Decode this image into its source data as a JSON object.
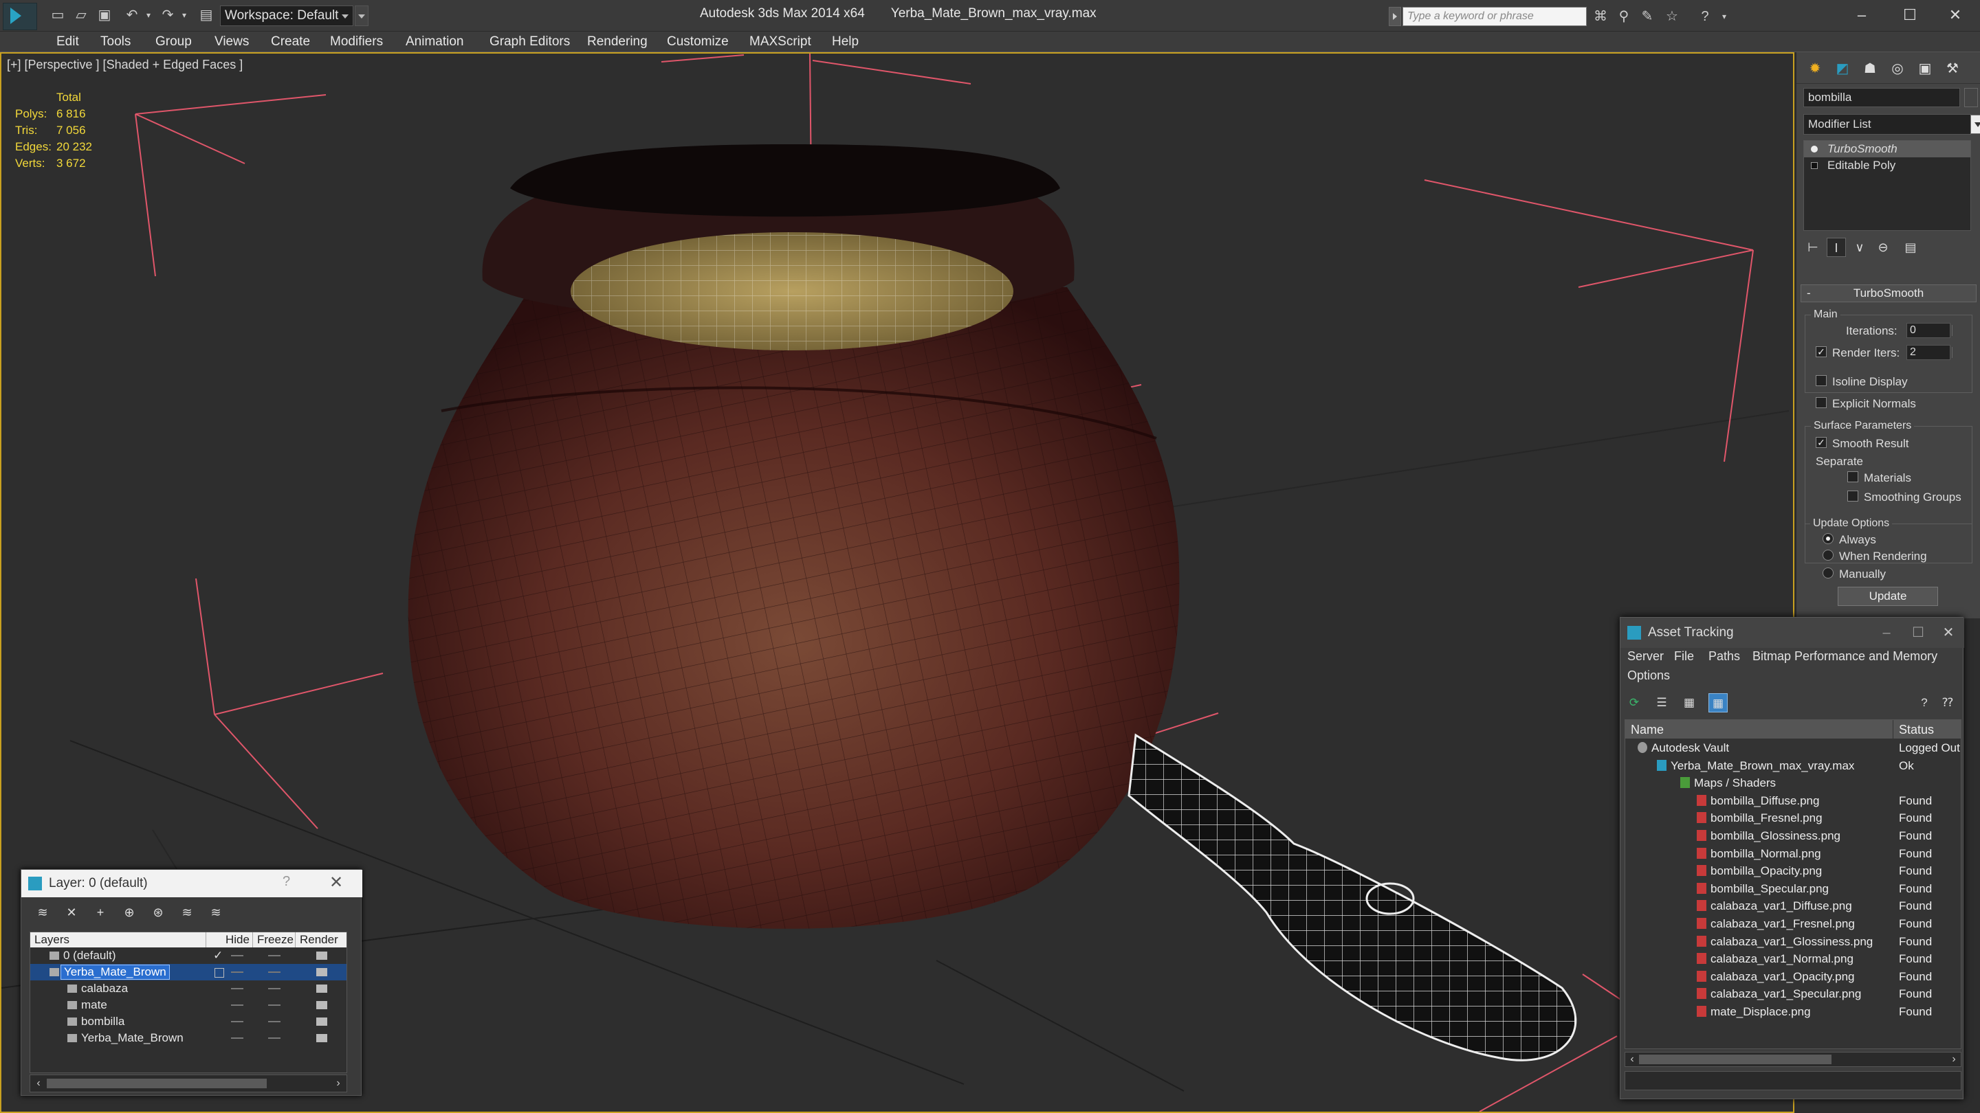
{
  "app": {
    "title": "Autodesk 3ds Max  2014 x64",
    "filename": "Yerba_Mate_Brown_max_vray.max",
    "workspace": "Workspace: Default",
    "search_placeholder": "Type a keyword or phrase"
  },
  "menu": [
    "Edit",
    "Tools",
    "Group",
    "Views",
    "Create",
    "Modifiers",
    "Animation",
    "Graph Editors",
    "Rendering",
    "Customize",
    "MAXScript",
    "Help"
  ],
  "viewport": {
    "label": "[+] [Perspective ] [Shaded + Edged Faces ]",
    "stats": {
      "header": "Total",
      "rows": [
        {
          "label": "Polys:",
          "value": "6 816"
        },
        {
          "label": "Tris:",
          "value": "7 056"
        },
        {
          "label": "Edges:",
          "value": "20 232"
        },
        {
          "label": "Verts:",
          "value": "3 672"
        }
      ]
    }
  },
  "command_panel": {
    "object_name": "bombilla",
    "modifier_list": "Modifier List",
    "stack": [
      "TurboSmooth",
      "Editable Poly"
    ],
    "rollout_title": "TurboSmooth",
    "rollout_minus": "-",
    "main": {
      "label": "Main",
      "iterations_label": "Iterations:",
      "iterations_value": "0",
      "render_iters_label": "Render Iters:",
      "render_iters_value": "2",
      "isoline_label": "Isoline Display",
      "explicit_label": "Explicit Normals"
    },
    "surface": {
      "label": "Surface Parameters",
      "smooth_result": "Smooth Result",
      "separate": "Separate",
      "materials": "Materials",
      "smoothing_groups": "Smoothing Groups"
    },
    "update": {
      "label": "Update Options",
      "always": "Always",
      "when_rendering": "When Rendering",
      "manually": "Manually",
      "button": "Update"
    }
  },
  "asset_tracking": {
    "title": "Asset Tracking",
    "menu": [
      "Server",
      "File",
      "Paths",
      "Bitmap Performance and Memory",
      "Options"
    ],
    "columns": {
      "name": "Name",
      "status": "Status"
    },
    "rows": [
      {
        "name": "Autodesk Vault",
        "status": "Logged Out",
        "level": 1,
        "icon": "vault-icon"
      },
      {
        "name": "Yerba_Mate_Brown_max_vray.max",
        "status": "Ok",
        "level": 2,
        "icon": "max-file-icon"
      },
      {
        "name": "Maps / Shaders",
        "status": "",
        "level": 3,
        "icon": "maps-folder-icon"
      },
      {
        "name": "bombilla_Diffuse.png",
        "status": "Found",
        "level": 4,
        "icon": "png-icon"
      },
      {
        "name": "bombilla_Fresnel.png",
        "status": "Found",
        "level": 4,
        "icon": "png-icon"
      },
      {
        "name": "bombilla_Glossiness.png",
        "status": "Found",
        "level": 4,
        "icon": "png-icon"
      },
      {
        "name": "bombilla_Normal.png",
        "status": "Found",
        "level": 4,
        "icon": "png-icon"
      },
      {
        "name": "bombilla_Opacity.png",
        "status": "Found",
        "level": 4,
        "icon": "png-icon"
      },
      {
        "name": "bombilla_Specular.png",
        "status": "Found",
        "level": 4,
        "icon": "png-icon"
      },
      {
        "name": "calabaza_var1_Diffuse.png",
        "status": "Found",
        "level": 4,
        "icon": "png-icon"
      },
      {
        "name": "calabaza_var1_Fresnel.png",
        "status": "Found",
        "level": 4,
        "icon": "png-icon"
      },
      {
        "name": "calabaza_var1_Glossiness.png",
        "status": "Found",
        "level": 4,
        "icon": "png-icon"
      },
      {
        "name": "calabaza_var1_Normal.png",
        "status": "Found",
        "level": 4,
        "icon": "png-icon"
      },
      {
        "name": "calabaza_var1_Opacity.png",
        "status": "Found",
        "level": 4,
        "icon": "png-icon"
      },
      {
        "name": "calabaza_var1_Specular.png",
        "status": "Found",
        "level": 4,
        "icon": "png-icon"
      },
      {
        "name": "mate_Displace.png",
        "status": "Found",
        "level": 4,
        "icon": "png-icon"
      }
    ]
  },
  "layer_panel": {
    "title": "Layer: 0 (default)",
    "help": "?",
    "columns": {
      "layers": "Layers",
      "hide": "Hide",
      "freeze": "Freeze",
      "render": "Render"
    },
    "rows": [
      {
        "name": "0 (default)",
        "level": 0,
        "selected": false
      },
      {
        "name": "Yerba_Mate_Brown",
        "level": 0,
        "selected": true
      },
      {
        "name": "calabaza",
        "level": 1,
        "selected": false
      },
      {
        "name": "mate",
        "level": 1,
        "selected": false
      },
      {
        "name": "bombilla",
        "level": 1,
        "selected": false
      },
      {
        "name": "Yerba_Mate_Brown",
        "level": 1,
        "selected": false
      }
    ]
  },
  "colors": {
    "accent": "#2a9cc0",
    "stats_text": "#f2d83a",
    "selection": "#2a6ecf",
    "helper_lines": "#e0566a",
    "viewport_border": "#c8a020"
  }
}
